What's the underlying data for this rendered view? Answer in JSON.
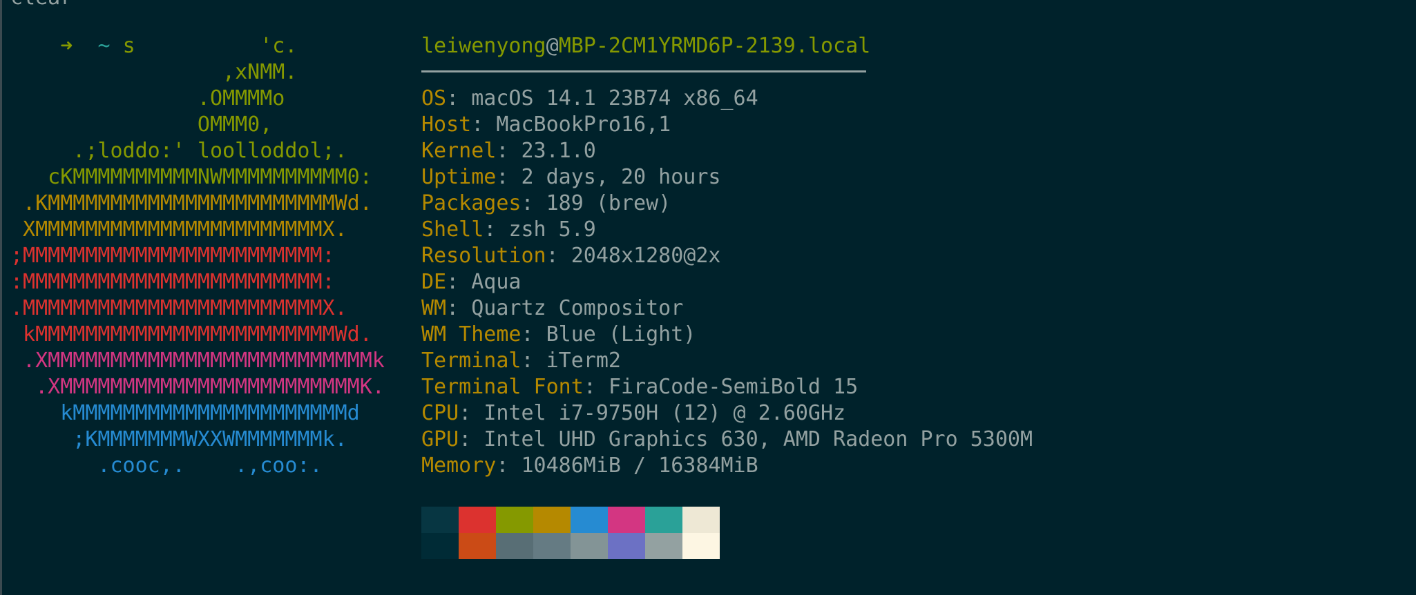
{
  "terminal": {
    "clipped_text": "clear",
    "prompt": {
      "arrow": "➜",
      "dir": "~",
      "command": "s"
    }
  },
  "logo": {
    "lines": [
      {
        "text": "                    'c.",
        "color": "#859900"
      },
      {
        "text": "                 ,xNMM.",
        "color": "#859900"
      },
      {
        "text": "               .OMMMMo",
        "color": "#859900"
      },
      {
        "text": "               OMMM0,",
        "color": "#859900"
      },
      {
        "text": "     .;loddo:' loolloddol;.",
        "color": "#859900"
      },
      {
        "text": "   cKMMMMMMMMMMNWMMMMMMMMMM0:",
        "color": "#859900"
      },
      {
        "text": " .KMMMMMMMMMMMMMMMMMMMMMMMWd.",
        "color": "#b58900"
      },
      {
        "text": " XMMMMMMMMMMMMMMMMMMMMMMMX.",
        "color": "#b58900"
      },
      {
        "text": ";MMMMMMMMMMMMMMMMMMMMMMMM:",
        "color": "#dc322f"
      },
      {
        "text": ":MMMMMMMMMMMMMMMMMMMMMMMM:",
        "color": "#dc322f"
      },
      {
        "text": ".MMMMMMMMMMMMMMMMMMMMMMMMX.",
        "color": "#dc322f"
      },
      {
        "text": " kMMMMMMMMMMMMMMMMMMMMMMMMWd.",
        "color": "#dc322f"
      },
      {
        "text": " .XMMMMMMMMMMMMMMMMMMMMMMMMMMk",
        "color": "#d33682"
      },
      {
        "text": "  .XMMMMMMMMMMMMMMMMMMMMMMMMK.",
        "color": "#d33682"
      },
      {
        "text": "    kMMMMMMMMMMMMMMMMMMMMMMd",
        "color": "#268bd2"
      },
      {
        "text": "     ;KMMMMMMMWXXWMMMMMMMk.",
        "color": "#268bd2"
      },
      {
        "text": "       .cooc,.    .,coo:.",
        "color": "#268bd2"
      }
    ]
  },
  "info": {
    "user": "leiwenyong",
    "at": "@",
    "host": "MBP-2CM1YRMD6P-2139.local",
    "fields": [
      {
        "label": "OS",
        "value": "macOS 14.1 23B74 x86_64"
      },
      {
        "label": "Host",
        "value": "MacBookPro16,1"
      },
      {
        "label": "Kernel",
        "value": "23.1.0"
      },
      {
        "label": "Uptime",
        "value": "2 days, 20 hours"
      },
      {
        "label": "Packages",
        "value": "189 (brew)"
      },
      {
        "label": "Shell",
        "value": "zsh 5.9"
      },
      {
        "label": "Resolution",
        "value": "2048x1280@2x"
      },
      {
        "label": "DE",
        "value": "Aqua"
      },
      {
        "label": "WM",
        "value": "Quartz Compositor"
      },
      {
        "label": "WM Theme",
        "value": "Blue (Light)"
      },
      {
        "label": "Terminal",
        "value": "iTerm2"
      },
      {
        "label": "Terminal Font",
        "value": "FiraCode-SemiBold 15"
      },
      {
        "label": "CPU",
        "value": "Intel i7-9750H (12) @ 2.60GHz"
      },
      {
        "label": "GPU",
        "value": "Intel UHD Graphics 630, AMD Radeon Pro 5300M"
      },
      {
        "label": "Memory",
        "value": "10486MiB / 16384MiB"
      }
    ]
  },
  "palette": {
    "normal": [
      "#073642",
      "#dc322f",
      "#859900",
      "#b58900",
      "#268bd2",
      "#d33682",
      "#2aa198",
      "#eee8d5"
    ],
    "bright": [
      "#002b36",
      "#cb4b16",
      "#586e75",
      "#657b83",
      "#839496",
      "#6c71c4",
      "#93a1a1",
      "#fdf6e3"
    ]
  }
}
